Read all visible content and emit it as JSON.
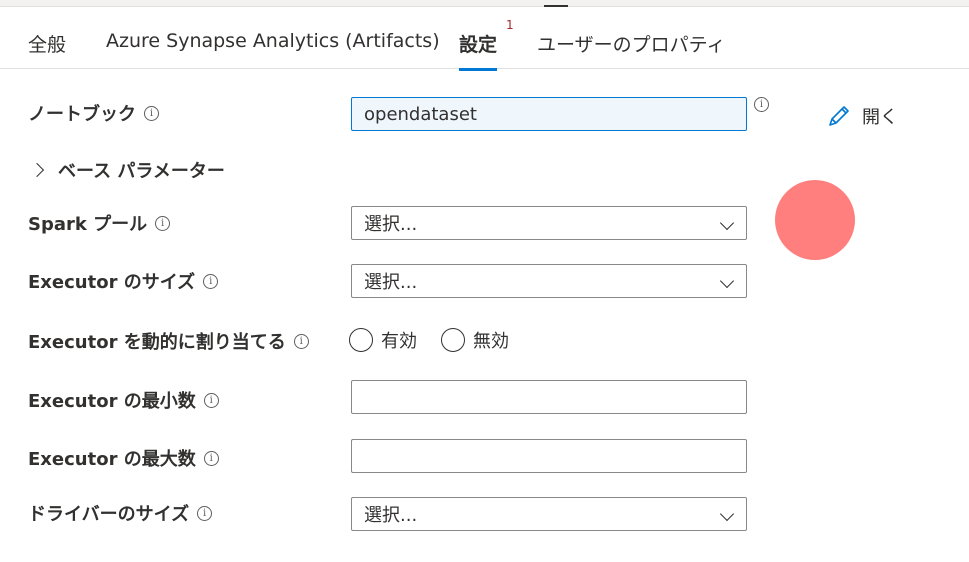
{
  "tabs": [
    {
      "label": "全般"
    },
    {
      "label": "Azure Synapse Analytics (Artifacts)"
    },
    {
      "label": "設定",
      "badge": "1"
    },
    {
      "label": "ユーザーのプロパティ"
    }
  ],
  "notebook": {
    "label": "ノートブック",
    "value": "opendataset",
    "open_label": "開く"
  },
  "base_params": {
    "label": "ベース パラメーター"
  },
  "spark_pool": {
    "label": "Spark プール",
    "placeholder": "選択..."
  },
  "executor_size": {
    "label": "Executor のサイズ",
    "placeholder": "選択..."
  },
  "dynamic_alloc": {
    "label": "Executor を動的に割り当てる",
    "option_on": "有効",
    "option_off": "無効"
  },
  "executor_min": {
    "label": "Executor の最小数",
    "value": ""
  },
  "executor_max": {
    "label": "Executor の最大数",
    "value": ""
  },
  "driver_size": {
    "label": "ドライバーのサイズ",
    "placeholder": "選択..."
  },
  "info_glyph": "i",
  "colors": {
    "accent": "#0078d4",
    "badge": "#a4262c",
    "cursor": "#ff7f7f"
  }
}
